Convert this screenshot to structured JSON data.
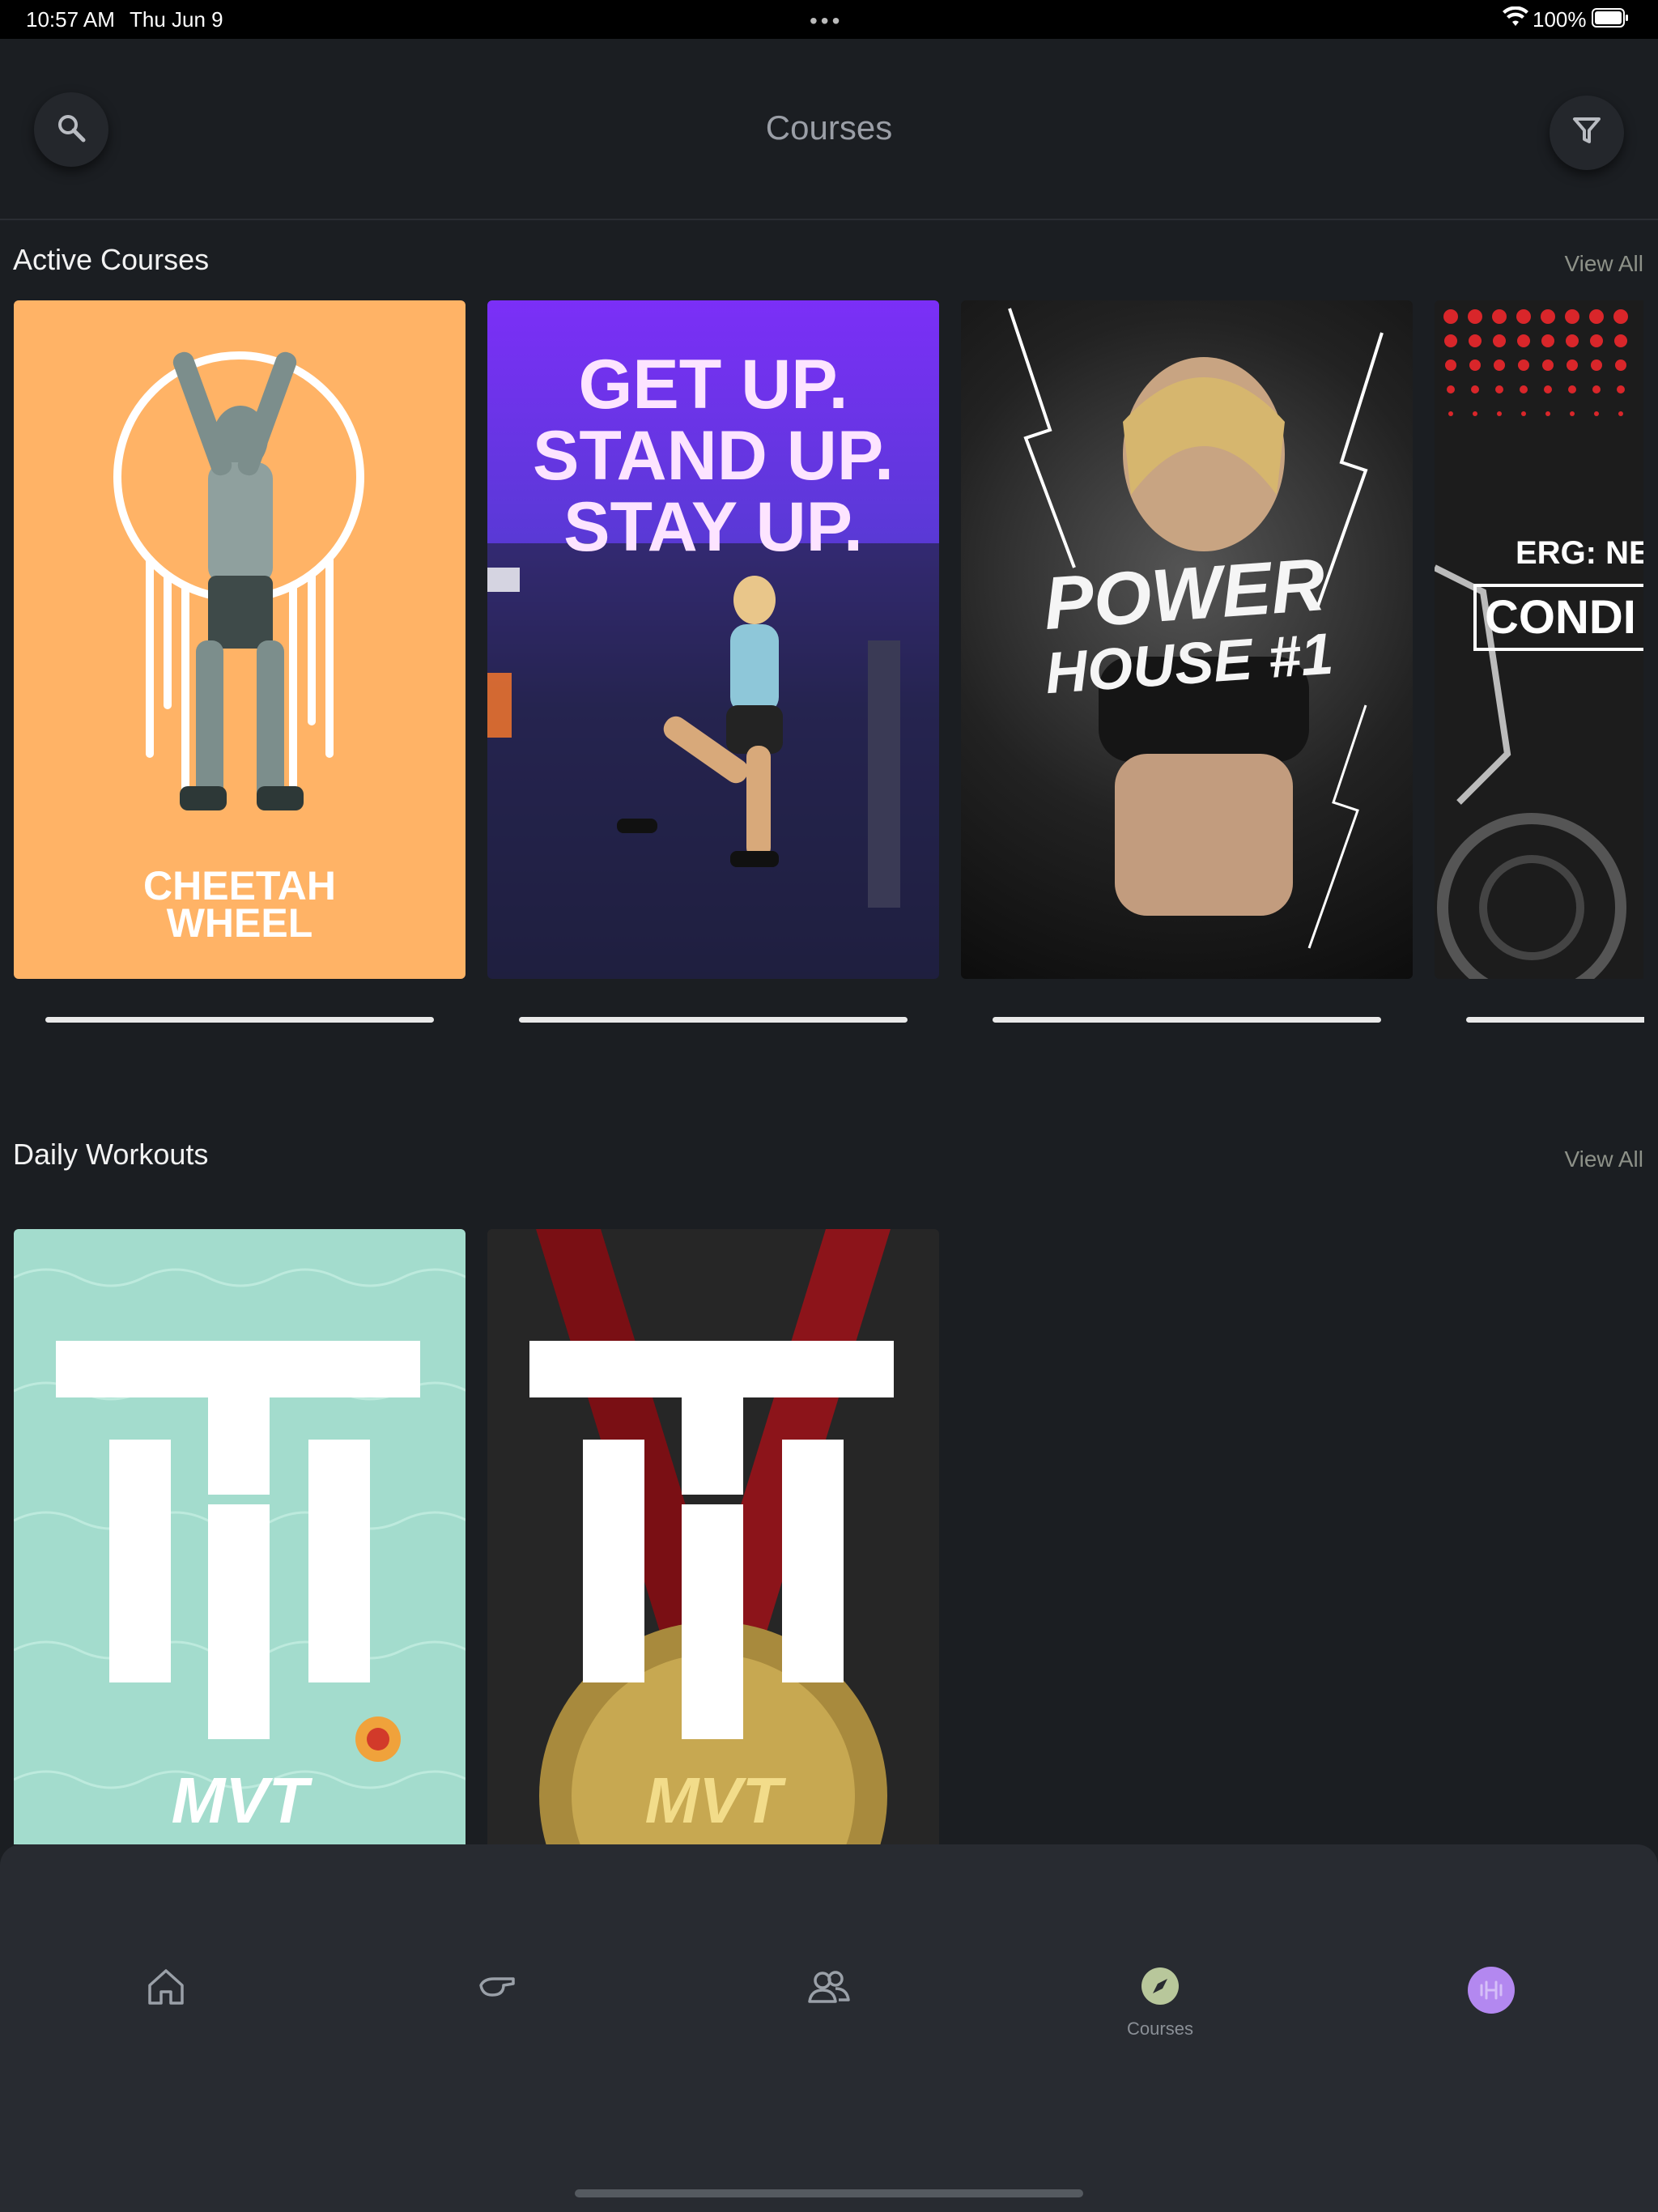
{
  "status_bar": {
    "time": "10:57 AM",
    "date": "Thu Jun 9",
    "multitask_dots": "•••",
    "battery": "100%"
  },
  "header": {
    "title": "Courses",
    "search_icon": "search-icon",
    "filter_icon": "filter-icon"
  },
  "active_courses": {
    "title": "Active Courses",
    "view_all": "View All",
    "items": [
      {
        "text_lines": [
          "CHEETAH",
          "WHEEL"
        ],
        "progress": 1.0,
        "bg": "#ffb366"
      },
      {
        "text_lines": [
          "GET UP.",
          "STAND UP.",
          "STAY UP."
        ],
        "progress": 1.0,
        "bg": "#6a33d6"
      },
      {
        "text_lines": [
          "POWER",
          "HOUSE #1"
        ],
        "progress": 1.0,
        "bg": "#111111"
      },
      {
        "text_lines": [
          "ERG: NE",
          "CONDI"
        ],
        "progress": 1.0,
        "bg": "#1a1a1a"
      }
    ]
  },
  "daily_workouts": {
    "title": "Daily Workouts",
    "view_all": "View All",
    "items": [
      {
        "brand": "MVT",
        "bg": "#9ed8c8"
      },
      {
        "brand": "MVT",
        "bg": "#2a2a2a"
      }
    ]
  },
  "tab_bar": {
    "tabs": [
      {
        "icon": "home-icon",
        "label": ""
      },
      {
        "icon": "whistle-icon",
        "label": ""
      },
      {
        "icon": "community-icon",
        "label": ""
      },
      {
        "icon": "compass-icon",
        "label": "Courses",
        "active": true
      },
      {
        "icon": "avatar-icon",
        "label": ""
      }
    ]
  },
  "colors": {
    "background": "#1b1e22",
    "tab_bar": "#282b31",
    "accent_active": "#b8c79b",
    "avatar": "#b388f0"
  }
}
